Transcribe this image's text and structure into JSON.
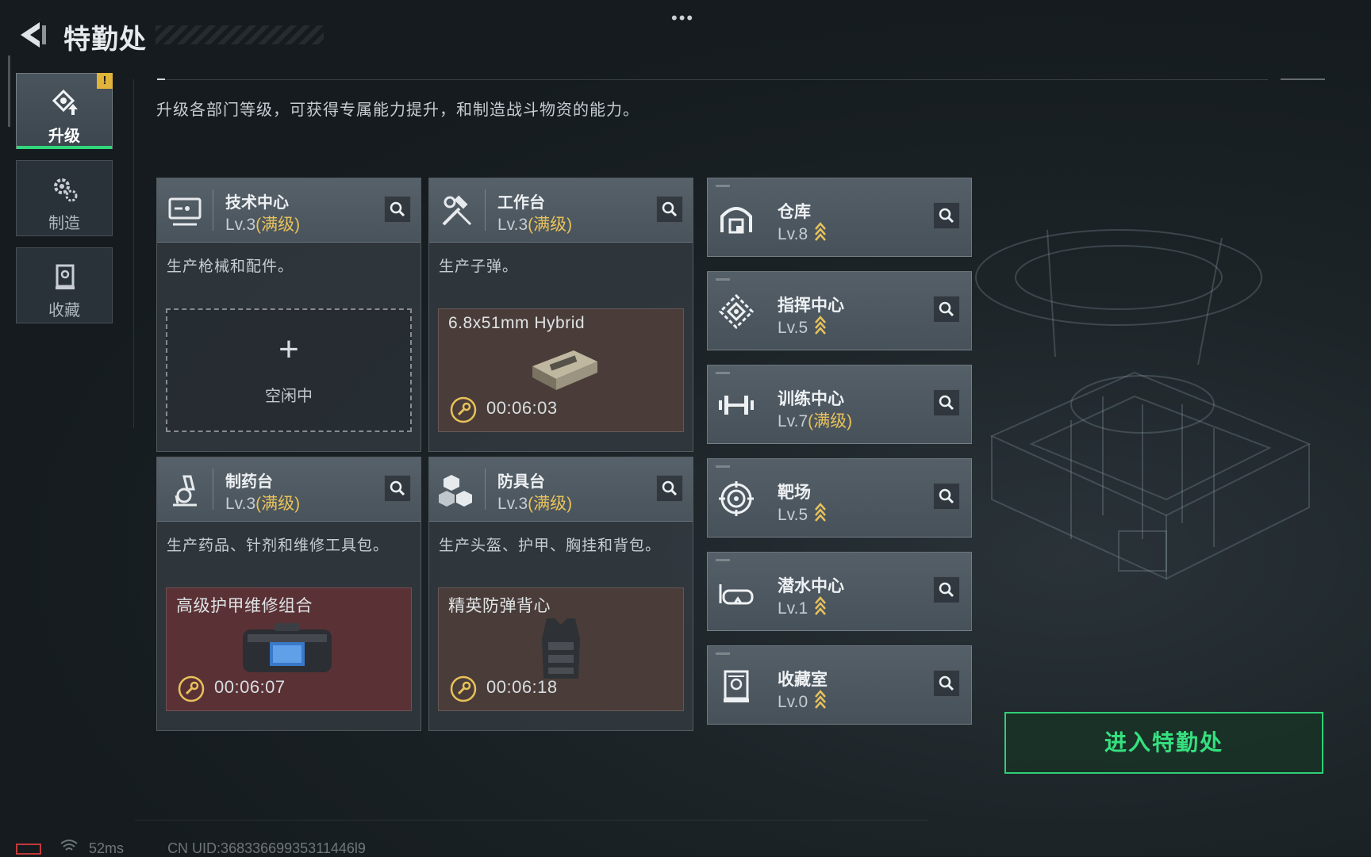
{
  "header": {
    "title": "特勤处",
    "more": "•••"
  },
  "description": "升级各部门等级，可获得专属能力提升，和制造战斗物资的能力。",
  "nav": {
    "items": [
      {
        "label": "升级",
        "icon": "upgrade-icon",
        "active": true,
        "badge": "!"
      },
      {
        "label": "制造",
        "icon": "gears-icon",
        "active": false
      },
      {
        "label": "收藏",
        "icon": "collection-icon",
        "active": false
      }
    ]
  },
  "cards": [
    {
      "name": "技术中心",
      "level": "Lv.3",
      "max": "(满级)",
      "desc": "生产枪械和配件。",
      "icon": "monitor-icon",
      "slot": {
        "state": "idle",
        "plus": "+",
        "label": "空闲中"
      }
    },
    {
      "name": "工作台",
      "level": "Lv.3",
      "max": "(满级)",
      "desc": "生产子弹。",
      "icon": "hammer-wrench-icon",
      "slot": {
        "state": "crafting",
        "item": "6.8x51mm Hybrid",
        "time": "00:06:03"
      }
    },
    {
      "name": "制药台",
      "level": "Lv.3",
      "max": "(满级)",
      "desc": "生产药品、针剂和维修工具包。",
      "icon": "microscope-icon",
      "slot": {
        "state": "crafting",
        "item": "高级护甲维修组合",
        "time": "00:06:07"
      }
    },
    {
      "name": "防具台",
      "level": "Lv.3",
      "max": "(满级)",
      "desc": "生产头盔、护甲、胸挂和背包。",
      "icon": "blocks-icon",
      "slot": {
        "state": "crafting",
        "item": "精英防弹背心",
        "time": "00:06:18"
      }
    }
  ],
  "facilities": [
    {
      "name": "仓库",
      "level": "Lv.8",
      "max": "",
      "upgradable": true,
      "icon": "warehouse-icon"
    },
    {
      "name": "指挥中心",
      "level": "Lv.5",
      "max": "",
      "upgradable": true,
      "icon": "command-icon"
    },
    {
      "name": "训练中心",
      "level": "Lv.7",
      "max": "(满级)",
      "upgradable": false,
      "icon": "dumbbell-icon"
    },
    {
      "name": "靶场",
      "level": "Lv.5",
      "max": "",
      "upgradable": true,
      "icon": "target-icon"
    },
    {
      "name": "潜水中心",
      "level": "Lv.1",
      "max": "",
      "upgradable": true,
      "icon": "diving-mask-icon"
    },
    {
      "name": "收藏室",
      "level": "Lv.0",
      "max": "",
      "upgradable": true,
      "icon": "trophy-case-icon"
    }
  ],
  "enter_button": "进入特勤处",
  "status": {
    "ping": "52ms",
    "uid": "CN UID:36833669935311446l9"
  },
  "colors": {
    "accent_green": "#31d67a",
    "max_gold": "#e8c25b",
    "alert": "#e0b43a"
  }
}
